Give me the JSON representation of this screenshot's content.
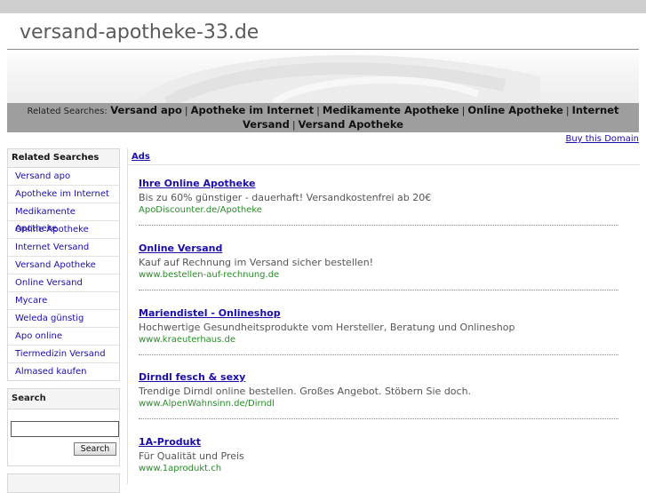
{
  "site": {
    "title": "versand-apotheke-33.de"
  },
  "related_bar": {
    "label": "Related Searches:",
    "items": [
      "Versand apo",
      "Apotheke im Internet",
      "Medikamente Apotheke",
      "Online Apotheke",
      "Internet Versand",
      "Versand Apotheke"
    ]
  },
  "buy_domain": "Buy this Domain",
  "sidebar": {
    "heading": "Related Searches",
    "items": [
      "Versand apo",
      "Apotheke im Internet",
      "Medikamente Apotheke",
      "Online Apotheke",
      "Internet Versand",
      "Versand Apotheke",
      "Online Versand",
      "Mycare",
      "Weleda günstig",
      "Apo online",
      "Tiermedizin Versand",
      "Almased kaufen"
    ]
  },
  "search": {
    "heading": "Search",
    "input_value": "",
    "button_label": "Search"
  },
  "main": {
    "ads_label": "Ads",
    "ads": [
      {
        "title": "Ihre Online Apotheke",
        "desc": "Bis zu 60% günstiger - dauerhaft! Versandkostenfrei ab 20€",
        "url": "ApoDiscounter.de/Apotheke"
      },
      {
        "title": "Online Versand",
        "desc": "Kauf auf Rechnung im Versand sicher bestellen!",
        "url": "www.bestellen-auf-rechnung.de"
      },
      {
        "title": "Mariendistel - Onlineshop",
        "desc": "Hochwertige Gesundheitsprodukte vom Hersteller, Beratung und Onlineshop",
        "url": "www.kraeuterhaus.de"
      },
      {
        "title": "Dirndl fesch & sexy",
        "desc": "Trendige Dirndl online bestellen. Großes Angebot. Stöbern Sie doch.",
        "url": "www.AlpenWahnsinn.de/Dirndl"
      },
      {
        "title": "1A-Produkt",
        "desc": "Für Qualität und Preis",
        "url": "www.1aprodukt.ch"
      }
    ]
  }
}
